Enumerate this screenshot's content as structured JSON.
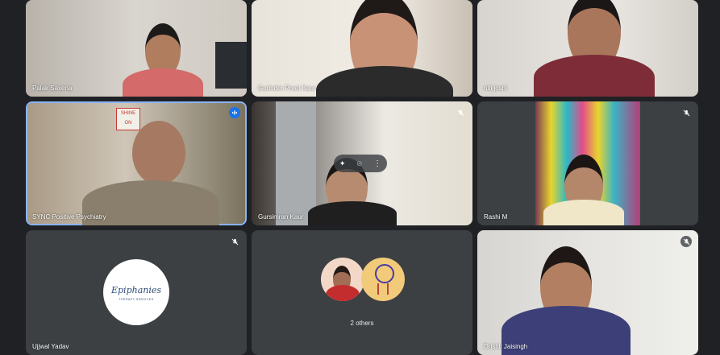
{
  "participants": [
    {
      "name": "Palak Saxena",
      "muted": false
    },
    {
      "name": "Gurinder Preet Kaur",
      "muted": false
    },
    {
      "name": "niti joshi",
      "muted": false
    },
    {
      "name": "SYNC Positive Psychiatry",
      "muted": false,
      "speaking": true
    },
    {
      "name": "Gursimran Kaur",
      "muted": true
    },
    {
      "name": "Rashi M",
      "muted": true
    },
    {
      "name": "Ujjwal Yadav",
      "muted": true,
      "avatar_logo": "Epiphanies",
      "avatar_logo_sub": "THERAPY SERVICES"
    },
    {
      "name": "Drishti Jaisingh",
      "muted": true
    }
  ],
  "others_tile": {
    "label": "2 others"
  },
  "colors": {
    "background": "#202124",
    "tile": "#3c4043",
    "speaking_accent": "#1a73e8",
    "active_border": "#8ab4f8"
  }
}
